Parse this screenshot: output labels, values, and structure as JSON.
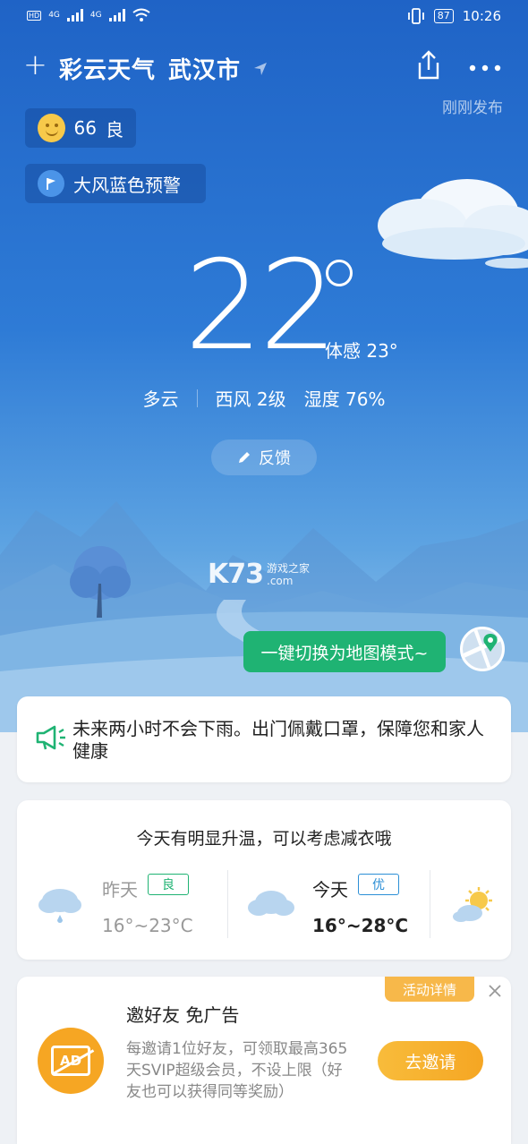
{
  "status_bar": {
    "network_1": "4G",
    "network_2": "4G",
    "battery": "87",
    "time": "10:26"
  },
  "header": {
    "add_label": "+",
    "app_name": "彩云天气",
    "city": "武汉市",
    "publish_time": "刚刚发布"
  },
  "aqi": {
    "value": "66",
    "level": "良"
  },
  "warning": {
    "label": "大风蓝色预警"
  },
  "current": {
    "temperature": "22",
    "feels_like": "体感 23°",
    "condition": "多云",
    "wind": "西风 2级",
    "humidity": "湿度 76%"
  },
  "feedback_label": "反馈",
  "watermark": {
    "brand": "K73",
    "sub_1": "游戏之家",
    "sub_2": ".com"
  },
  "map_mode_label": "一键切换为地图模式~",
  "rain_notice": "未来两小时不会下雨。出门佩戴口罩，保障您和家人健康",
  "temperature_card": {
    "title": "今天有明显升温，可以考虑减衣哦",
    "yesterday": {
      "label": "昨天",
      "badge": "良",
      "range": "16°~23°C"
    },
    "today": {
      "label": "今天",
      "badge": "优",
      "range": "16°~28°C"
    }
  },
  "invite_card": {
    "activity_label": "活动详情",
    "title": "邀好友 免广告",
    "description": "每邀请1位好友，可领取最高365天SVIP超级会员，不设上限（好友也可以获得同等奖励）",
    "button": "去邀请",
    "ad_badge": "AD"
  },
  "colors": {
    "sky_top": "#1f63c6",
    "map_button": "#1fb373",
    "invite_button": "#f5a623",
    "badge_good": "#1fb373",
    "badge_excellent": "#2c8fd6"
  }
}
